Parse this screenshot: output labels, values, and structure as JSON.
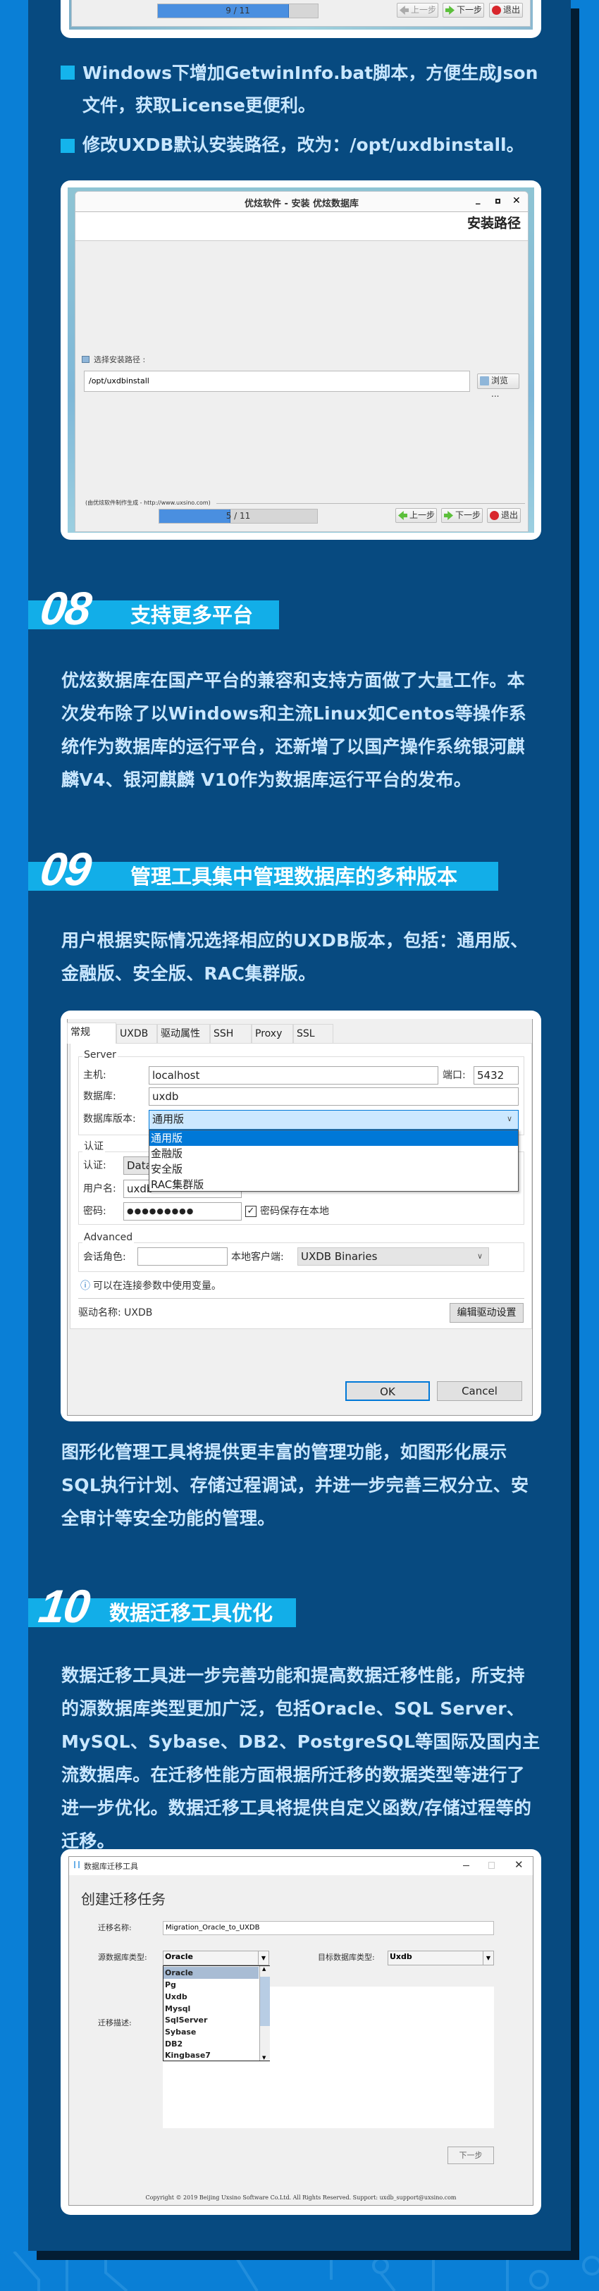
{
  "colors": {
    "page_bg": "#0a7fd6",
    "panel_bg": "#074a80",
    "accent_cyan": "#12aee8",
    "body_text": "#c9e7ff"
  },
  "top_installer": {
    "progress_label": "9 / 11",
    "progress_fraction": 0.82,
    "prev_label": "上一步",
    "next_label": "下一步",
    "exit_label": "退出"
  },
  "bullets": [
    {
      "text": "Windows下增加GetwinInfo.bat脚本，方便生成Json文件，获取License更便利。"
    },
    {
      "text": "修改UXDB默认安装路径，改为：/opt/uxdbinstall。"
    }
  ],
  "installer": {
    "title": "优炫软件 - 安装 优炫数据库",
    "header": "安装路径",
    "path_label": "选择安装路径 :",
    "path_value": "/opt/uxdbinstall",
    "browse_label": "浏览 ...",
    "footer": "(由优炫软件制作生成 - http://www.uxsino.com)",
    "progress_label": "5 / 11",
    "progress_fraction": 0.45,
    "prev_label": "上一步",
    "next_label": "下一步",
    "exit_label": "退出"
  },
  "sections": [
    {
      "number": "08",
      "title": "支持更多平台",
      "text": "优炫数据库在国产平台的兼容和支持方面做了大量工作。本次发布除了以Windows和主流Linux如Centos等操作系统作为数据库的运行平台，还新增了以国产操作系统银河麒麟V4、银河麒麟 V10作为数据库运行平台的发布。"
    },
    {
      "number": "09",
      "title": "管理工具集中管理数据库的多种版本",
      "text": "用户根据实际情况选择相应的UXDB版本，包括：通用版、金融版、安全版、RAC集群版。",
      "text2": "图形化管理工具将提供更丰富的管理功能，如图形化展示SQL执行计划、存储过程调试，并进一步完善三权分立、安全审计等安全功能的管理。"
    },
    {
      "number": "10",
      "title": "数据迁移工具优化",
      "text": "数据迁移工具进一步完善功能和提高数据迁移性能，所支持的源数据库类型更加广泛，包括Oracle、SQL Server、MySQL、Sybase、DB2、PostgreSQL等国际及国内主流数据库。在迁移性能方面根据所迁移的数据类型等进行了进一步优化。数据迁移工具将提供自定义函数/存储过程等的迁移。"
    }
  ],
  "conn_dialog": {
    "tabs": [
      "常规",
      "UXDB",
      "驱动属性",
      "SSH",
      "Proxy",
      "SSL"
    ],
    "server_group": "Server",
    "host_label": "主机:",
    "host_value": "localhost",
    "port_label": "端口:",
    "port_value": "5432",
    "db_label": "数据库:",
    "db_value": "uxdb",
    "version_label": "数据库版本:",
    "version_value": "通用版",
    "version_options": [
      "通用版",
      "金融版",
      "安全版",
      "RAC集群版"
    ],
    "auth_group": "认证",
    "auth_label": "认证:",
    "auth_value": "Data",
    "user_label": "用户名:",
    "user_value": "uxdb",
    "pwd_label": "密码:",
    "pwd_value": "●●●●●●●●●",
    "save_pwd_label": "密码保存在本地",
    "save_pwd_checked": true,
    "advanced_group": "Advanced",
    "role_label": "会话角色:",
    "role_value": "",
    "client_label": "本地客户端:",
    "client_value": "UXDB Binaries",
    "info": "可以在连接参数中使用变量。",
    "driver_label": "驱动名称: UXDB",
    "edit_driver_label": "编辑驱动设置",
    "ok_label": "OK",
    "cancel_label": "Cancel"
  },
  "migration": {
    "title": "数据库迁移工具",
    "heading": "创建迁移任务",
    "name_label": "迁移名称:",
    "name_value": "Migration_Oracle_to_UXDB",
    "src_label": "源数据库类型:",
    "src_value": "Oracle",
    "dst_label": "目标数据库类型:",
    "dst_value": "Uxdb",
    "src_options": [
      "Oracle",
      "Pg",
      "Uxdb",
      "Mysql",
      "SqlServer",
      "Sybase",
      "DB2",
      "Kingbase7"
    ],
    "desc_label": "迁移描述:",
    "next_label": "下一步",
    "copyright": "Copyright © 2019 Beijing Uxsino Software Co.Ltd. All Rights Reserved. Support: uxdb_support@uxsino.com"
  }
}
